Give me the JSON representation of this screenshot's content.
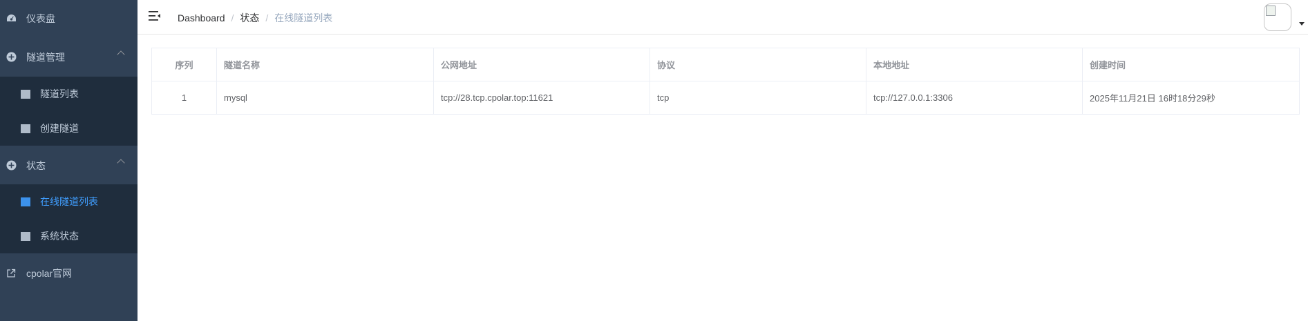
{
  "sidebar": {
    "dashboard": "仪表盘",
    "tunnel_management": {
      "label": "隧道管理",
      "items": [
        "隧道列表",
        "创建隧道"
      ]
    },
    "status": {
      "label": "状态",
      "items": [
        "在线隧道列表",
        "系统状态"
      ]
    },
    "cpolar_site": "cpolar官网",
    "colors": {
      "bg": "#304156",
      "submenu_bg": "#1f2d3d",
      "text": "#bfcbd9",
      "active": "#409eff"
    }
  },
  "header": {
    "breadcrumb": [
      "Dashboard",
      "状态",
      "在线隧道列表"
    ],
    "separator": "/"
  },
  "table": {
    "columns": [
      "序列",
      "隧道名称",
      "公网地址",
      "协议",
      "本地地址",
      "创建时间"
    ],
    "rows": [
      [
        "1",
        "mysql",
        "tcp://28.tcp.cpolar.top:11621",
        "tcp",
        "tcp://127.0.0.1:3306",
        "2025年11月21日 16时18分29秒"
      ]
    ]
  }
}
